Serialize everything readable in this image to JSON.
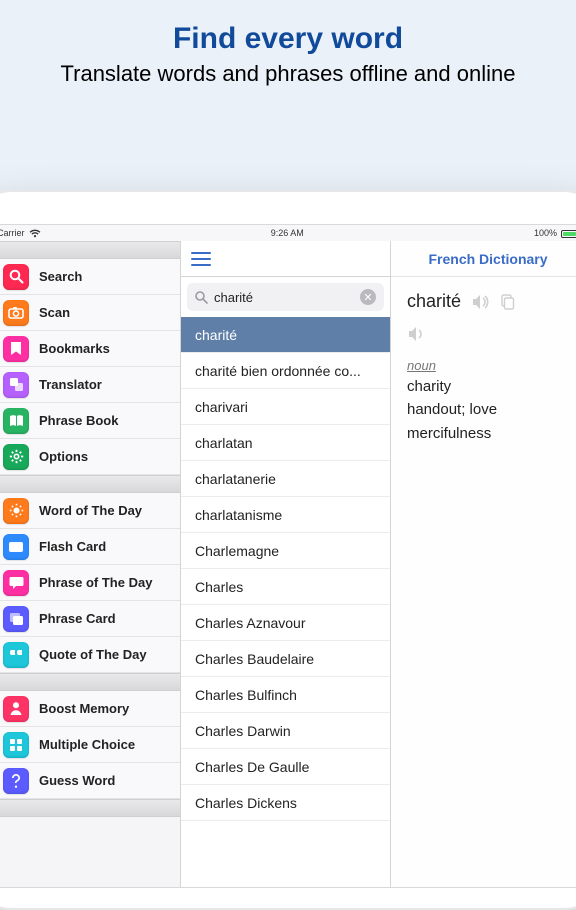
{
  "promo": {
    "headline": "Find every word",
    "subline": "Translate words and phrases offline and online"
  },
  "status": {
    "carrier": "Carrier",
    "time": "9:26 AM",
    "battery": "100%"
  },
  "sidebar": {
    "groups": [
      [
        {
          "label": "Search",
          "icon": "search-icon",
          "color": "#ff2851"
        },
        {
          "label": "Scan",
          "icon": "camera-icon",
          "color": "#ff7a1a"
        },
        {
          "label": "Bookmarks",
          "icon": "bookmark-icon",
          "color": "#ff2fa3"
        },
        {
          "label": "Translator",
          "icon": "translate-icon",
          "color": "#b560ff"
        },
        {
          "label": "Phrase Book",
          "icon": "phrasebook-icon",
          "color": "#28b463"
        },
        {
          "label": "Options",
          "icon": "gear-icon",
          "color": "#18a85a"
        }
      ],
      [
        {
          "label": "Word of The Day",
          "icon": "sun-icon",
          "color": "#ff7a1a"
        },
        {
          "label": "Flash Card",
          "icon": "card-icon",
          "color": "#2e8bff"
        },
        {
          "label": "Phrase of The Day",
          "icon": "speech-icon",
          "color": "#ff2fa3"
        },
        {
          "label": "Phrase Card",
          "icon": "stack-icon",
          "color": "#5b5bff"
        },
        {
          "label": "Quote of The Day",
          "icon": "quote-icon",
          "color": "#1dc6d9"
        }
      ],
      [
        {
          "label": "Boost Memory",
          "icon": "person-icon",
          "color": "#ff3366"
        },
        {
          "label": "Multiple Choice",
          "icon": "grid-icon",
          "color": "#1dc6d9"
        },
        {
          "label": "Guess Word",
          "icon": "quiz-icon",
          "color": "#5b5bff"
        }
      ]
    ]
  },
  "search": {
    "query": "charité",
    "results": [
      "charité",
      "charité bien ordonnée co...",
      "charivari",
      "charlatan",
      "charlatanerie",
      "charlatanisme",
      "Charlemagne",
      "Charles",
      "Charles Aznavour",
      "Charles Baudelaire",
      "Charles Bulfinch",
      "Charles Darwin",
      "Charles De Gaulle",
      "Charles Dickens"
    ],
    "selected_index": 0
  },
  "detail": {
    "app_title": "French Dictionary",
    "headword": "charité",
    "part_of_speech": "noun",
    "definitions": [
      "charity",
      "handout; love",
      "mercifulness"
    ]
  }
}
